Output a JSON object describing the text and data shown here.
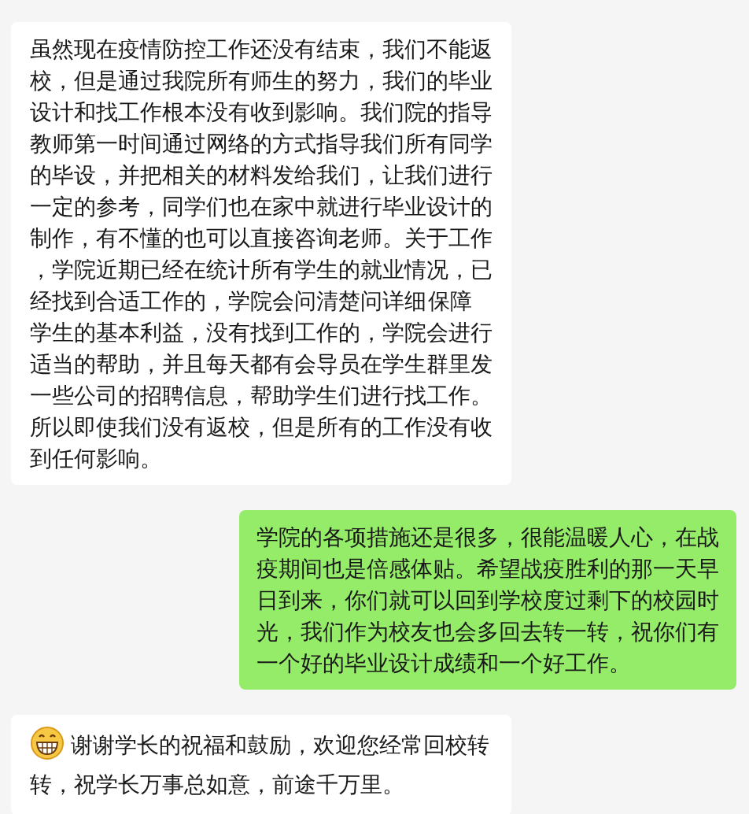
{
  "messages": [
    {
      "kind": "received",
      "has_emoji": false,
      "text": "虽然现在疫情防控工作还没有结束，我们不能返校，但是通过我院所有师生的努力，我们的毕业设计和找工作根本没有收到影响。我们院的指导教师第一时间通过网络的方式指导我们所有同学的毕设，并把相关的材料发给我们，让我们进行一定的参考，同学们也在家中就进行毕业设计的制作，有不懂的也可以直接咨询老师。关于工作，学院近期已经在统计所有学生的就业情况，已经找到合适工作的，学院会问清楚问详细 保障学生的基本利益，没有找到工作的，学院会进行适当的帮助，并且每天都有会导员在学生群里发一些公司的招聘信息，帮助学生们进行找工作。所以即使我们没有返校，但是所有的工作没有收到任何影响。"
    },
    {
      "kind": "sent",
      "has_emoji": false,
      "text": "学院的各项措施还是很多，很能温暖人心，在战疫期间也是倍感体贴。希望战疫胜利的那一天早日到来，你们就可以回到学校度过剩下的校园时光，我们作为校友也会多回去转一转，祝你们有一个好的毕业设计成绩和一个好工作。"
    },
    {
      "kind": "received",
      "has_emoji": true,
      "text": "谢谢学长的祝福和鼓励，欢迎您经常回校转转，祝学长万事总如意，前途千万里。"
    }
  ]
}
